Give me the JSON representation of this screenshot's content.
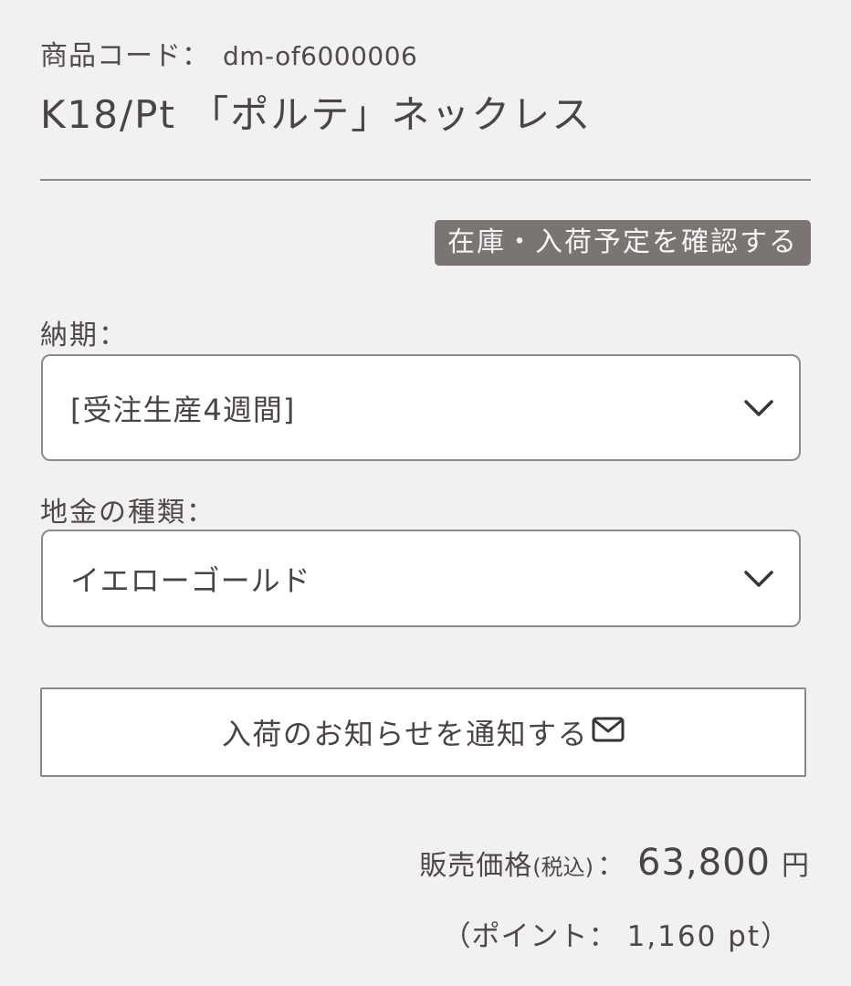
{
  "product": {
    "code_label": "商品コード：",
    "code_value": "dm-of6000006",
    "title": "K18/Pt 「ポルテ」ネックレス"
  },
  "stock_button_label": "在庫・入荷予定を確認する",
  "delivery": {
    "label": "納期：",
    "selected": "[受注生産4週間]"
  },
  "metal": {
    "label": "地金の種類：",
    "selected": "イエローゴールド"
  },
  "notify_button_label": "入荷のお知らせを通知する",
  "price": {
    "label": "販売価格",
    "tax_note": "(税込)",
    "colon": "：",
    "value": "63,800",
    "unit": "円"
  },
  "points": {
    "prefix": "（ポイント：",
    "value": "1,160 pt）"
  },
  "colors": {
    "background": "#f1f1f1",
    "text": "#4a4442",
    "button_dark": "#7a7473",
    "border": "#8f8a89"
  },
  "icons": {
    "select_arrow": "chevron-down-icon",
    "notify": "mail-icon"
  }
}
